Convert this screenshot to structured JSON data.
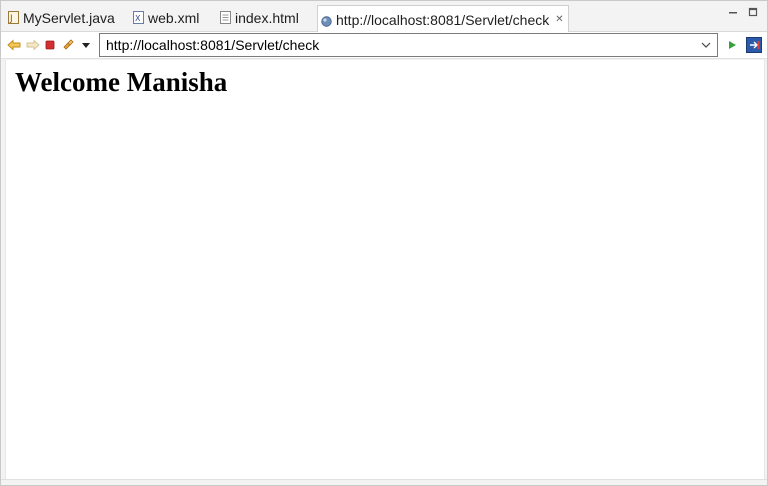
{
  "tabs": [
    {
      "label": "MyServlet.java",
      "icon": "java-file-icon",
      "active": false
    },
    {
      "label": "web.xml",
      "icon": "xml-file-icon",
      "active": false
    },
    {
      "label": "index.html",
      "icon": "html-file-icon",
      "active": false
    },
    {
      "label": "http://localhost:8081/Servlet/check",
      "icon": "globe-icon",
      "active": true,
      "close": "✕"
    }
  ],
  "toolbar": {
    "url": "http://localhost:8081/Servlet/check",
    "buttons": [
      "back-icon",
      "forward-icon",
      "stop-icon",
      "refresh-icon",
      "menu-dropdown-icon",
      "go-icon",
      "open-external-icon"
    ]
  },
  "page": {
    "heading": "Welcome Manisha"
  },
  "colors": {
    "accent_arrow": "#e0a020",
    "stop": "#d23030",
    "go": "#3aa03a",
    "external_bg": "#2a5aa8"
  }
}
